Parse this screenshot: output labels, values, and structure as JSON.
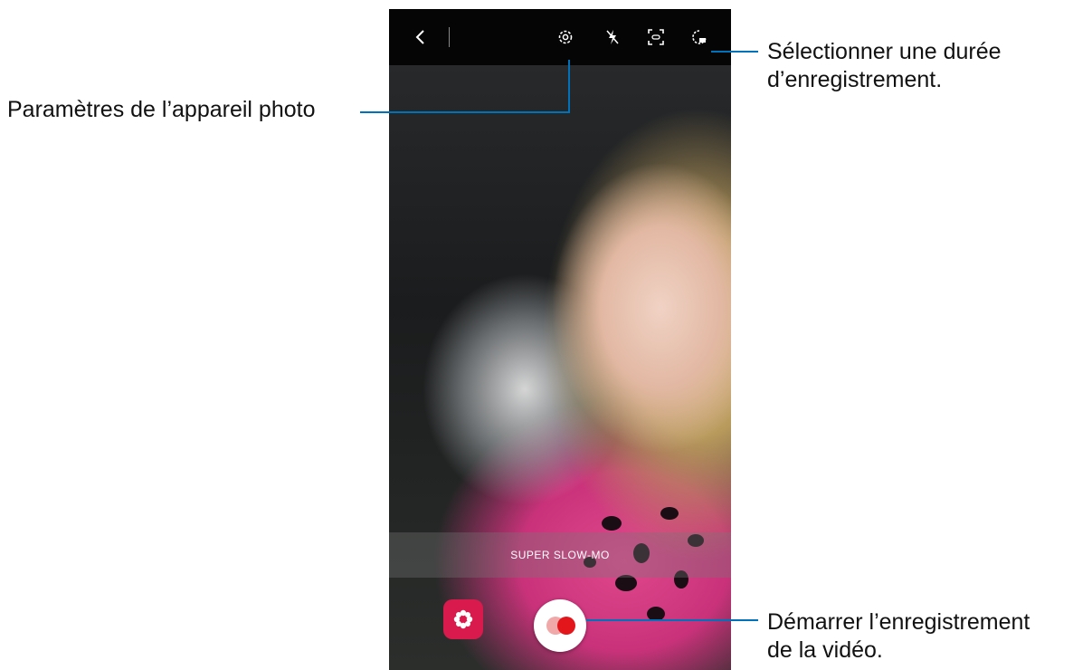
{
  "topbar": {
    "icons": [
      "back-icon",
      "settings-gear-icon",
      "flash-off-icon",
      "auto-detect-icon",
      "duration-timer-icon"
    ]
  },
  "camera": {
    "mode_label": "SUPER SLOW-MO"
  },
  "callouts": {
    "settings": "Paramètres de l’appareil photo",
    "duration_line1": "Sélectionner une durée",
    "duration_line2": "d’enregistrement.",
    "record_line1": "Démarrer l’enregistrement",
    "record_line2": "de la vidéo."
  },
  "colors": {
    "callout_line": "#0072bc",
    "effects_button": "#d81a4c",
    "record_dot": "#e3161c"
  }
}
